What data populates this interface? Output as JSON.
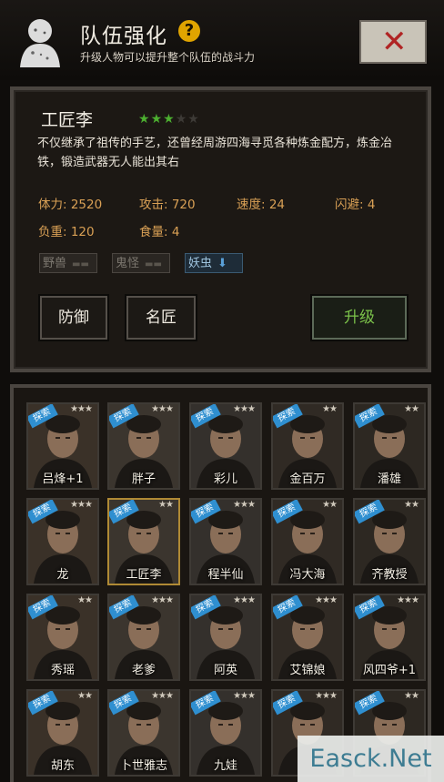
{
  "header": {
    "title": "队伍强化",
    "help_symbol": "?",
    "subtitle": "升级人物可以提升整个队伍的战斗力",
    "close_symbol": "✕"
  },
  "character": {
    "name": "工匠李",
    "stars_filled": 3,
    "stars_total": 5,
    "description": "不仅继承了祖传的手艺，还曾经周游四海寻觅各种炼金配方，炼金冶铁，锻造武器无人能出其右",
    "stats": [
      {
        "label": "体力: 2520"
      },
      {
        "label": "攻击: 720"
      },
      {
        "label": "速度: 24"
      },
      {
        "label": "闪避: 4"
      },
      {
        "label": "负重: 120"
      },
      {
        "label": "食量: 4"
      }
    ],
    "tags": [
      {
        "label": "野兽",
        "active": false
      },
      {
        "label": "鬼怪",
        "active": false
      },
      {
        "label": "妖虫",
        "active": true
      }
    ],
    "buttons": {
      "defense": "防御",
      "master": "名匠",
      "upgrade": "升级"
    }
  },
  "roster": [
    {
      "name": "吕烽+1",
      "badge": "探索",
      "stars": "★★★"
    },
    {
      "name": "胖子",
      "badge": "探索",
      "stars": "★★★"
    },
    {
      "name": "彩儿",
      "badge": "探索",
      "stars": "★★★"
    },
    {
      "name": "金百万",
      "badge": "探索",
      "stars": "★★"
    },
    {
      "name": "潘雄",
      "badge": "探索",
      "stars": "★★"
    },
    {
      "name": "龙",
      "badge": "探索",
      "stars": "★★★"
    },
    {
      "name": "工匠李",
      "badge": "探索",
      "stars": "★★"
    },
    {
      "name": "程半仙",
      "badge": "探索",
      "stars": "★★★"
    },
    {
      "name": "冯大海",
      "badge": "探索",
      "stars": "★★"
    },
    {
      "name": "齐教授",
      "badge": "探索",
      "stars": "★★"
    },
    {
      "name": "秀瑶",
      "badge": "探索",
      "stars": "★★"
    },
    {
      "name": "老爹",
      "badge": "探索",
      "stars": "★★★"
    },
    {
      "name": "阿英",
      "badge": "探索",
      "stars": "★★★"
    },
    {
      "name": "艾锦娘",
      "badge": "探索",
      "stars": "★★★"
    },
    {
      "name": "风四爷+1",
      "badge": "探索",
      "stars": "★★★"
    },
    {
      "name": "胡东",
      "badge": "探索",
      "stars": "★★"
    },
    {
      "name": "卜世雅志",
      "badge": "探索",
      "stars": "★★★"
    },
    {
      "name": "九娃",
      "badge": "探索",
      "stars": "★★★"
    },
    {
      "name": "",
      "badge": "探索",
      "stars": "★★★"
    },
    {
      "name": "",
      "badge": "探索",
      "stars": "★★"
    }
  ],
  "watermark": "Easck.Net",
  "colors": {
    "help_badge": "#e0a400",
    "star_on": "#4caf30",
    "stat_text": "#d9a055",
    "upgrade_text": "#7bc24a",
    "explore_badge": "#2f8fd0",
    "selected_border": "#b08a35"
  }
}
